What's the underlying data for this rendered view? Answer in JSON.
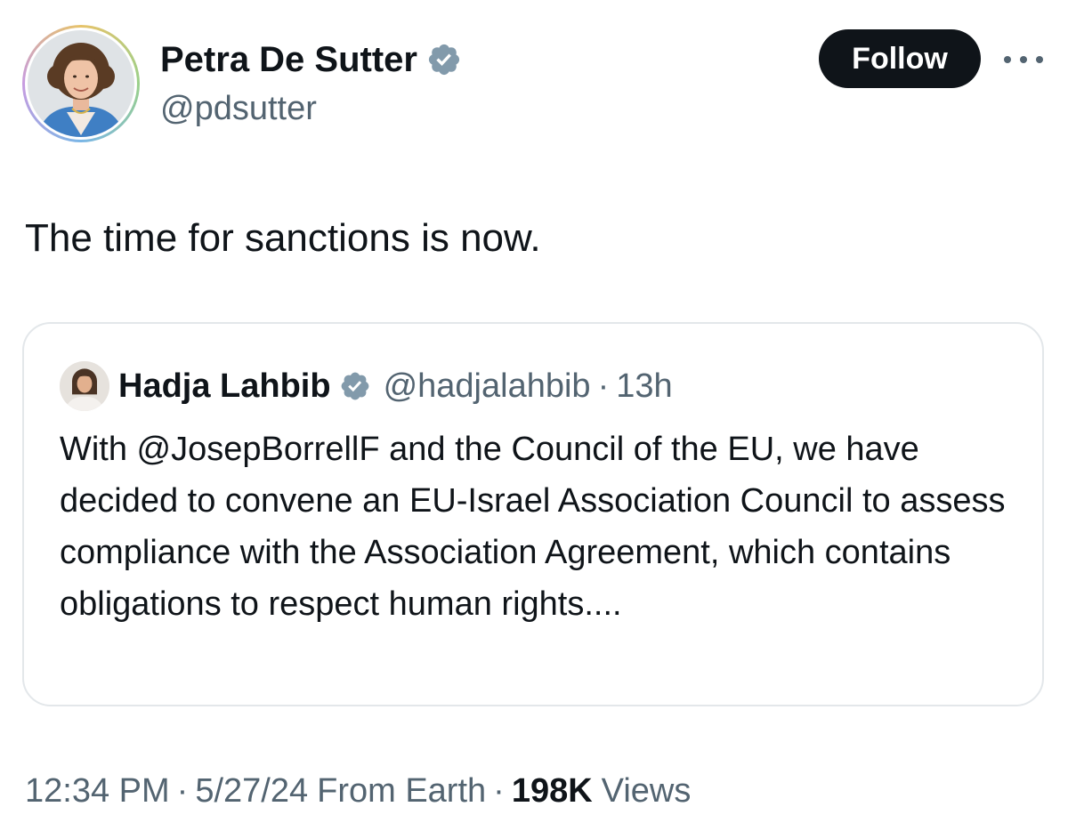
{
  "author": {
    "name": "Petra De Sutter",
    "handle": "@pdsutter",
    "verified": true,
    "avatar": "avatar-portrait-woman"
  },
  "follow_button": {
    "label": "Follow"
  },
  "more_menu": {
    "icon": "more-horizontal-icon"
  },
  "tweet": {
    "text": "The time for sanctions is now."
  },
  "quoted_tweet": {
    "author_name": "Hadja Lahbib",
    "author_handle": "@hadjalahbib",
    "separator": "·",
    "time_ago": "13h",
    "verified": true,
    "text": "With @JosepBorrellF and the Council of the EU, we have decided to convene an EU-Israel Association Council to assess compliance with the Association Agreement, which contains obligations to respect human rights...."
  },
  "meta": {
    "time": "12:34 PM",
    "date": "5/27/24",
    "source": "From Earth",
    "views_count": "198K",
    "views_label": "Views",
    "separator": "·"
  },
  "colors": {
    "text_primary": "#0f1419",
    "text_secondary": "#536471",
    "verified_badge": "#829aab",
    "follow_bg": "#0f1419",
    "card_border": "#e3e7ea"
  }
}
